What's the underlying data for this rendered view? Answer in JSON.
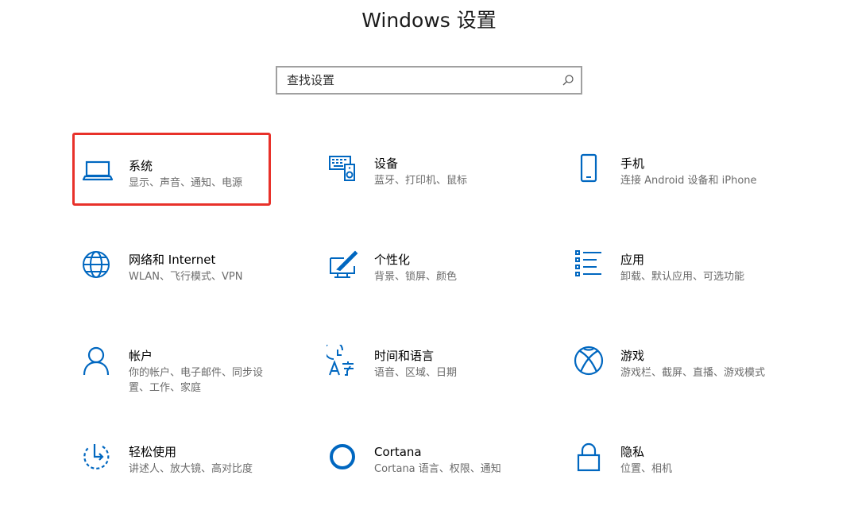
{
  "window_title": "Windows 设置",
  "search": {
    "placeholder": "查找设置"
  },
  "accent_color": "#0067c0",
  "highlight_color": "#e8312a",
  "tiles": [
    {
      "name": "系统",
      "desc": "显示、声音、通知、电源",
      "icon": "laptop-icon",
      "highlighted": true
    },
    {
      "name": "设备",
      "desc": "蓝牙、打印机、鼠标",
      "icon": "devices-icon"
    },
    {
      "name": "手机",
      "desc": "连接 Android 设备和 iPhone",
      "icon": "phone-icon"
    },
    {
      "name": "网络和 Internet",
      "desc": "WLAN、飞行模式、VPN",
      "icon": "globe-icon"
    },
    {
      "name": "个性化",
      "desc": "背景、锁屏、颜色",
      "icon": "personalization-icon"
    },
    {
      "name": "应用",
      "desc": "卸载、默认应用、可选功能",
      "icon": "apps-list-icon"
    },
    {
      "name": "帐户",
      "desc": "你的帐户、电子邮件、同步设置、工作、家庭",
      "icon": "person-icon"
    },
    {
      "name": "时间和语言",
      "desc": "语音、区域、日期",
      "icon": "time-language-icon"
    },
    {
      "name": "游戏",
      "desc": "游戏栏、截屏、直播、游戏模式",
      "icon": "xbox-icon"
    },
    {
      "name": "轻松使用",
      "desc": "讲述人、放大镜、高对比度",
      "icon": "ease-of-access-icon"
    },
    {
      "name": "Cortana",
      "desc": "Cortana 语言、权限、通知",
      "icon": "cortana-icon"
    },
    {
      "name": "隐私",
      "desc": "位置、相机",
      "icon": "lock-icon"
    }
  ]
}
